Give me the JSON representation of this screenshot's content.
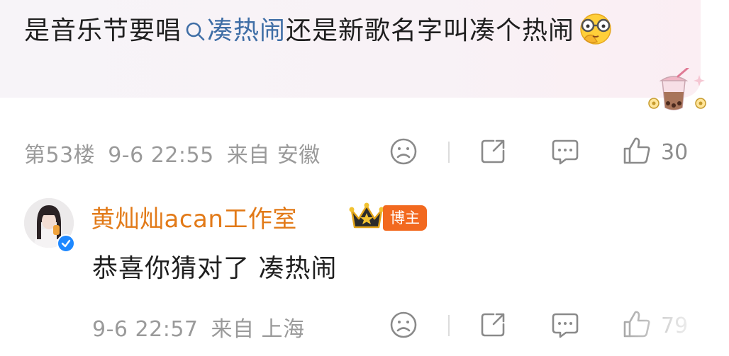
{
  "comment": {
    "text_before": "是音乐节要唱",
    "topic": "凑热闹",
    "text_after": "还是新歌名字叫凑个热闹",
    "floor": "第53楼",
    "date": "9-6 22:55",
    "source": "来自 安徽",
    "likes": "30"
  },
  "reply": {
    "author": "黄灿灿acan工作室",
    "badge": "博主",
    "text": "恭喜你猜对了 凑热闹",
    "date": "9-6 22:57",
    "source": "来自 上海",
    "likes": "79"
  },
  "colors": {
    "topic": "#3f6ea6",
    "author": "#e27a18",
    "badge": "#f2691f",
    "meta": "#9a9a9a",
    "verify": "#1e88ff"
  },
  "icons": [
    "search-icon",
    "thinking-emoji-icon",
    "boba-sticker-icon",
    "sad-face-icon",
    "share-icon",
    "comment-icon",
    "like-icon",
    "crown-icon",
    "verified-icon"
  ]
}
